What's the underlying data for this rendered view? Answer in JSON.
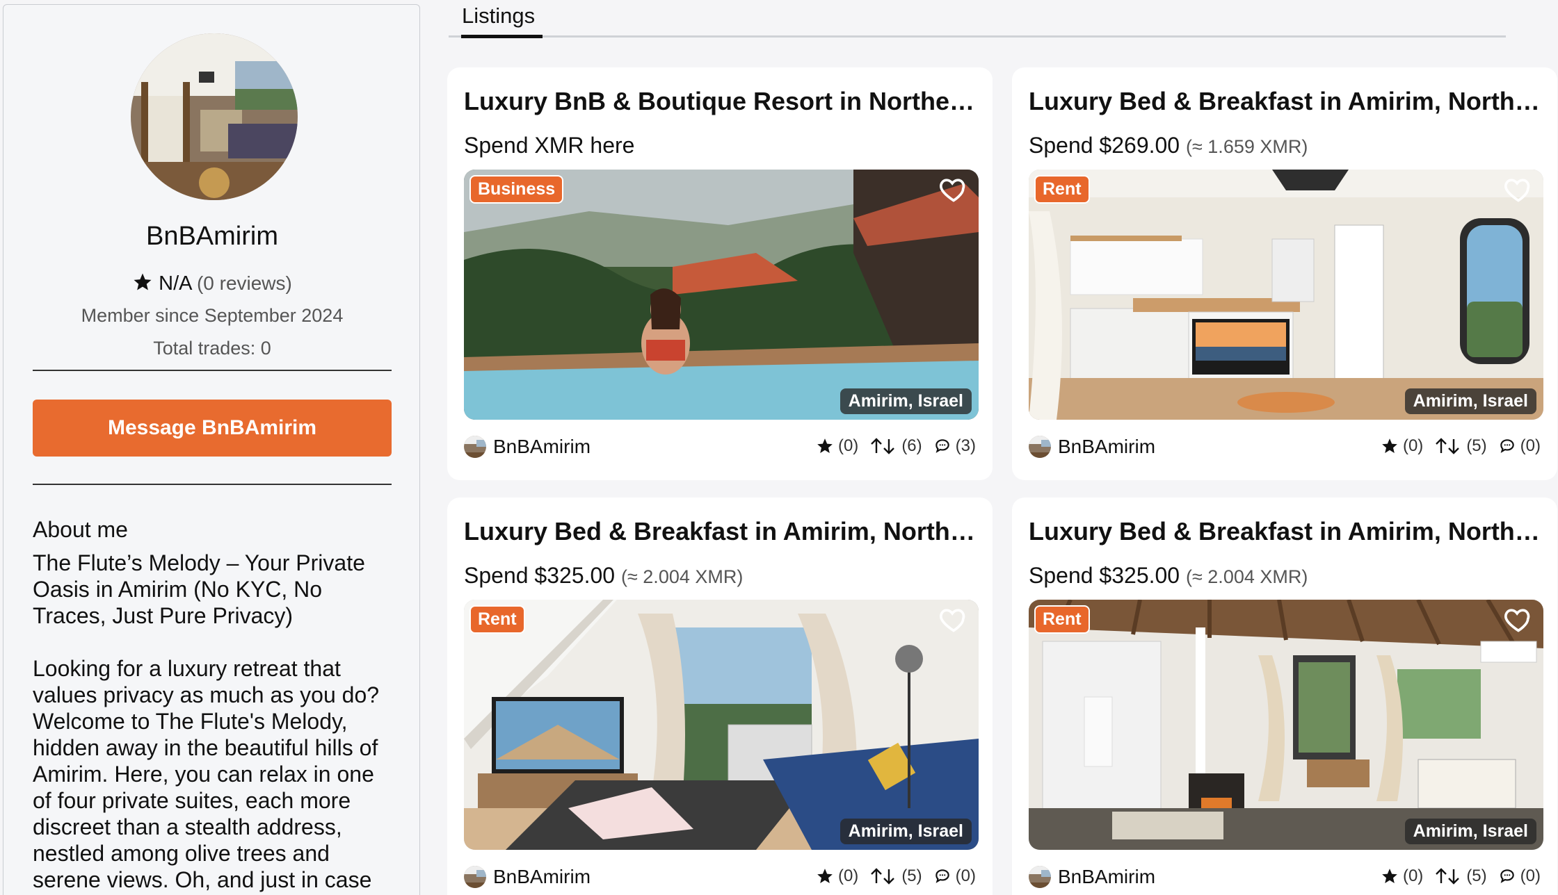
{
  "profile": {
    "username": "BnBAmirim",
    "rating": "N/A",
    "reviews": "(0 reviews)",
    "member_since": "Member since September 2024",
    "total_trades": "Total trades: 0",
    "message_button": "Message BnBAmirim",
    "about_title": "About me",
    "about_tagline": "The Flute’s Melody – Your Private Oasis in Amirim (No KYC, No Traces, Just Pure Privacy)",
    "about_body": "Looking for a luxury retreat that values privacy as much as you do? Welcome to The Flute's Melody, hidden away in the beautiful hills of Amirim. Here, you can relax in one of four private suites, each more discreet than a stealth address, nestled among olive trees and serene views. Oh, and just in case you're like us, we only take cash."
  },
  "tabs": {
    "active": "Listings"
  },
  "listings": [
    {
      "title": "Luxury BnB & Boutique Resort in Northern Israel – Amirim",
      "price": "Spend XMR here",
      "approx": "",
      "badge": "Business",
      "location": "Amirim, Israel",
      "seller": "BnBAmirim",
      "stats": {
        "stars": "(0)",
        "trades": "(6)",
        "comments": "(3)"
      }
    },
    {
      "title": "Luxury Bed & Breakfast in Amirim, Northern Israel",
      "price": "Spend $269.00",
      "approx": "(≈ 1.659 XMR)",
      "badge": "Rent",
      "location": "Amirim, Israel",
      "seller": "BnBAmirim",
      "stats": {
        "stars": "(0)",
        "trades": "(5)",
        "comments": "(0)"
      }
    },
    {
      "title": "Luxury Bed & Breakfast in Amirim, Northern Israel",
      "price": "Spend $325.00",
      "approx": "(≈ 2.004 XMR)",
      "badge": "Rent",
      "location": "Amirim, Israel",
      "seller": "BnBAmirim",
      "stats": {
        "stars": "(0)",
        "trades": "(5)",
        "comments": "(0)"
      }
    },
    {
      "title": "Luxury Bed & Breakfast in Amirim, Northern Israel",
      "price": "Spend $325.00",
      "approx": "(≈ 2.004 XMR)",
      "badge": "Rent",
      "location": "Amirim, Israel",
      "seller": "BnBAmirim",
      "stats": {
        "stars": "(0)",
        "trades": "(5)",
        "comments": "(0)"
      }
    }
  ],
  "colors": {
    "accent": "#e86b2f",
    "badge": "#e8672b"
  },
  "icons": {
    "star": "star-icon",
    "heart": "heart-icon",
    "trades": "arrows-up-down-icon",
    "comments": "comment-icon"
  }
}
